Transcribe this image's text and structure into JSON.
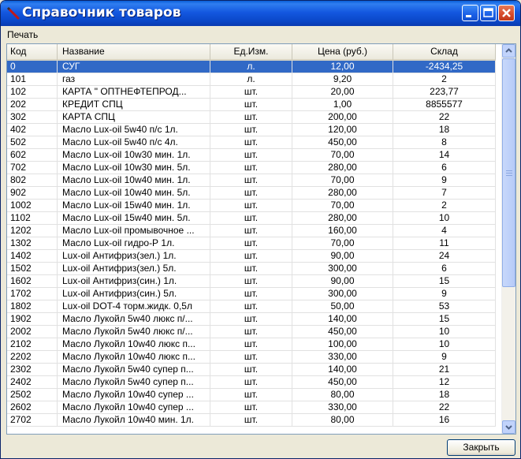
{
  "window": {
    "title": "Справочник товаров"
  },
  "menu": {
    "items": [
      "Печать"
    ]
  },
  "table": {
    "columns": [
      "Код",
      "Название",
      "Ед.Изм.",
      "Цена (руб.)",
      "Склад"
    ],
    "selected_row": 0,
    "rows": [
      [
        "0",
        "СУГ",
        "л.",
        "12,00",
        "-2434,25"
      ],
      [
        "101",
        "газ",
        "л.",
        "9,20",
        "2"
      ],
      [
        "102",
        "КАРТА \" ОПТНЕФТЕПРОД...",
        "шт.",
        "20,00",
        "223,77"
      ],
      [
        "202",
        "КРЕДИТ СПЦ",
        "шт.",
        "1,00",
        "8855577"
      ],
      [
        "302",
        "КАРТА СПЦ",
        "шт.",
        "200,00",
        "22"
      ],
      [
        "402",
        "Масло Lux-oil 5w40 п/с  1л.",
        "шт.",
        "120,00",
        "18"
      ],
      [
        "502",
        "Масло Lux-oil 5w40 п/с  4л.",
        "шт.",
        "450,00",
        "8"
      ],
      [
        "602",
        "Масло Lux-oil 10w30 мин.  1л.",
        "шт.",
        "70,00",
        "14"
      ],
      [
        "702",
        "Масло Lux-oil 10w30 мин.  5л.",
        "шт.",
        "280,00",
        "6"
      ],
      [
        "802",
        "Масло Lux-oil 10w40 мин.  1л.",
        "шт.",
        "70,00",
        "9"
      ],
      [
        "902",
        "Масло Lux-oil 10w40 мин.  5л.",
        "шт.",
        "280,00",
        "7"
      ],
      [
        "1002",
        "Масло Lux-oil 15w40 мин.  1л.",
        "шт.",
        "70,00",
        "2"
      ],
      [
        "1102",
        "Масло Lux-oil 15w40 мин.  5л.",
        "шт.",
        "280,00",
        "10"
      ],
      [
        "1202",
        "Масло Lux-oil промывочное  ...",
        "шт.",
        "160,00",
        "4"
      ],
      [
        "1302",
        "Масло Lux-oil  гидро-Р  1л.",
        "шт.",
        "70,00",
        "11"
      ],
      [
        "1402",
        "Lux-oil  Антифриз(зел.) 1л.",
        "шт.",
        "90,00",
        "24"
      ],
      [
        "1502",
        "Lux-oil  Антифриз(зел.)  5л.",
        "шт.",
        "300,00",
        "6"
      ],
      [
        "1602",
        "Lux-oil  Антифриз(син.)  1л.",
        "шт.",
        "90,00",
        "15"
      ],
      [
        "1702",
        "Lux-oil  Антифриз(син.)  5л.",
        "шт.",
        "300,00",
        "9"
      ],
      [
        "1802",
        "Lux-oil  DOT-4 торм.жидк. 0,5л",
        "шт.",
        "50,00",
        "53"
      ],
      [
        "1902",
        "Масло Лукойл 5w40 люкс п/...",
        "шт.",
        "140,00",
        "15"
      ],
      [
        "2002",
        "Масло Лукойл 5w40 люкс п/...",
        "шт.",
        "450,00",
        "10"
      ],
      [
        "2102",
        "Масло Лукойл 10w40 люкс п...",
        "шт.",
        "100,00",
        "10"
      ],
      [
        "2202",
        "Масло Лукойл 10w40 люкс п...",
        "шт.",
        "330,00",
        "9"
      ],
      [
        "2302",
        "Масло Лукойл 5w40 супер п...",
        "шт.",
        "140,00",
        "21"
      ],
      [
        "2402",
        "Масло Лукойл 5w40 супер п...",
        "шт.",
        "450,00",
        "12"
      ],
      [
        "2502",
        "Масло Лукойл 10w40 супер ...",
        "шт.",
        "80,00",
        "18"
      ],
      [
        "2602",
        "Масло Лукойл 10w40 супер ...",
        "шт.",
        "330,00",
        "22"
      ],
      [
        "2702",
        "Масло Лукойл 10w40 мин.  1л.",
        "шт.",
        "80,00",
        "16"
      ]
    ]
  },
  "buttons": {
    "close_label": "Закрыть"
  },
  "colors": {
    "titlebar": "#1458e0",
    "selection": "#3169c6",
    "close_button_red": "#d6492a"
  }
}
